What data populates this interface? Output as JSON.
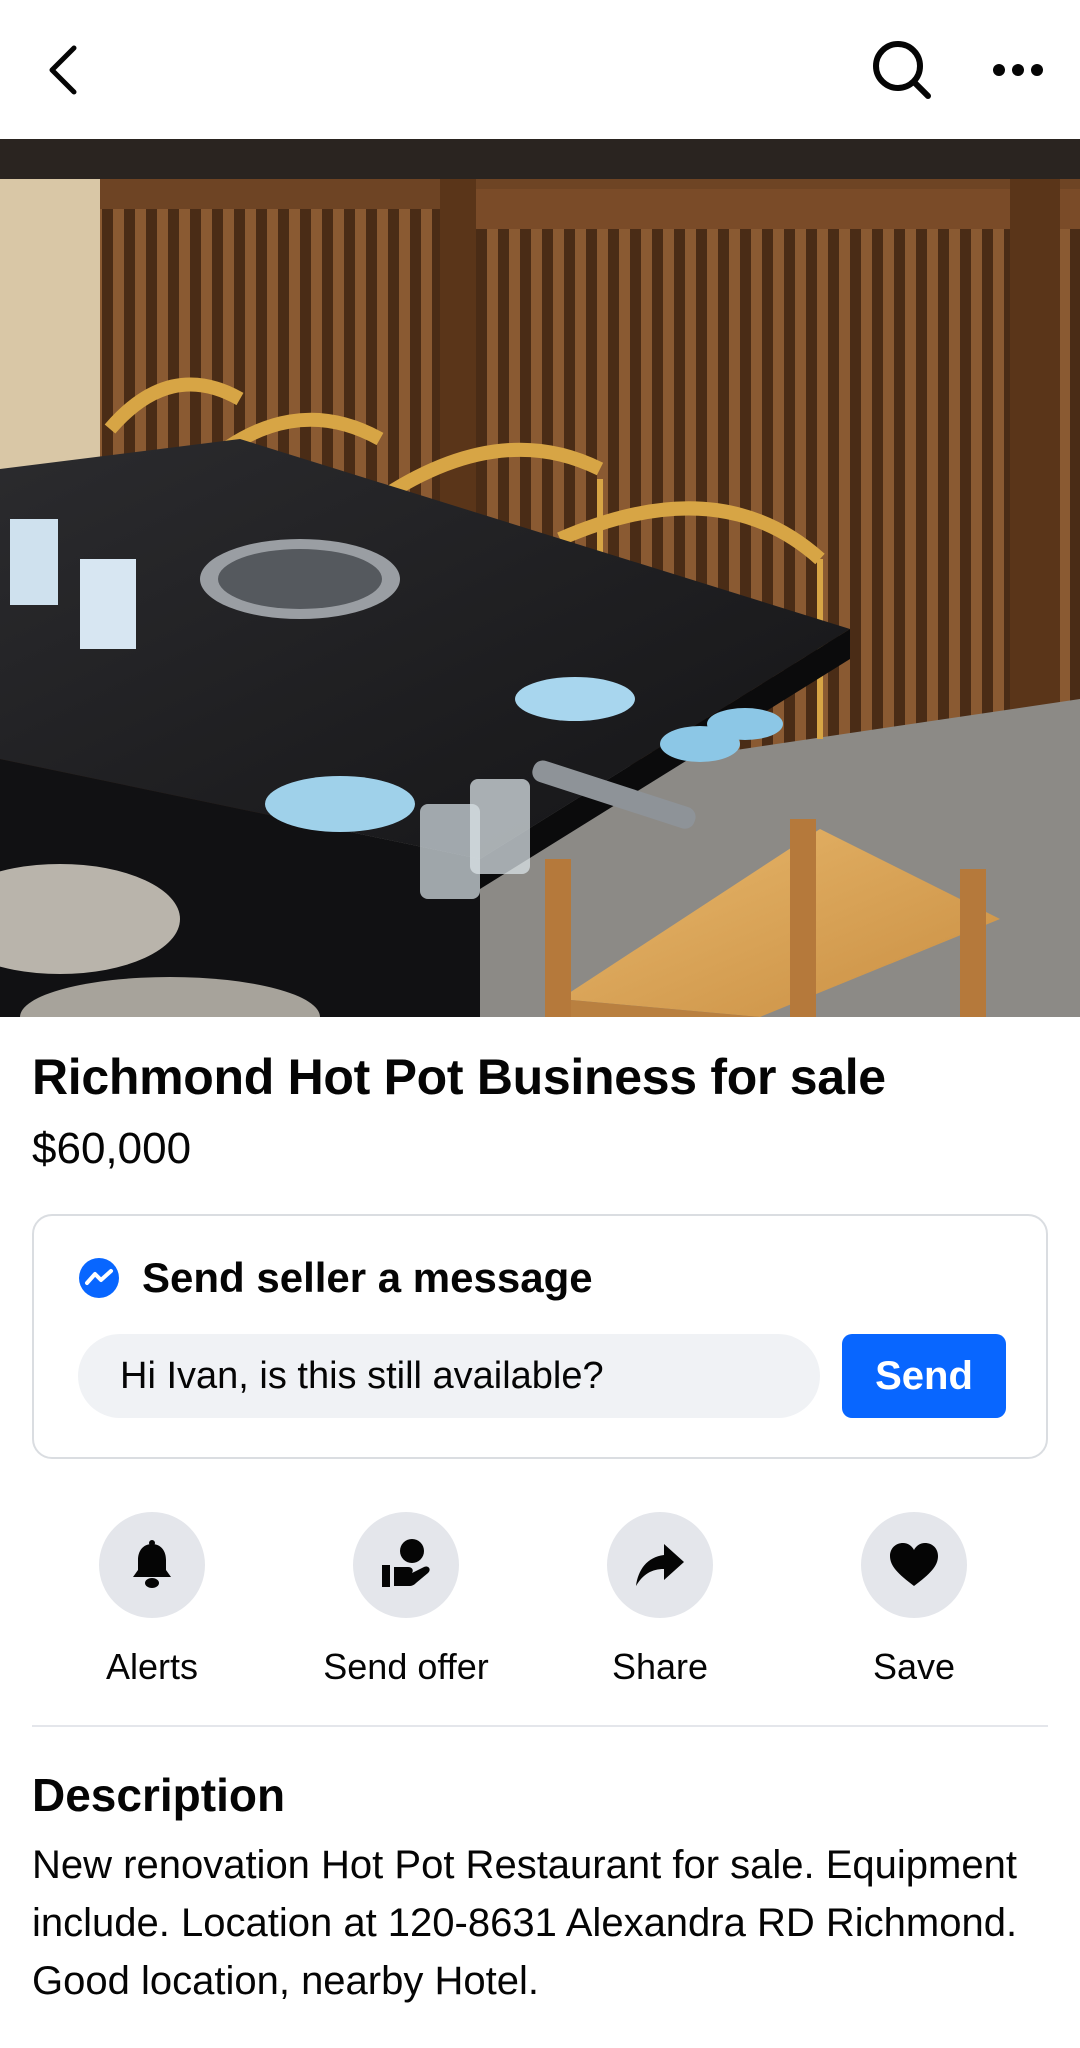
{
  "header": {
    "back_icon": "chevron-left-icon",
    "search_icon": "search-icon",
    "more_icon": "more-horizontal-icon"
  },
  "listing": {
    "photo_description": "listing-photo",
    "title": "Richmond Hot Pot Business for sale",
    "price": "$60,000"
  },
  "message": {
    "heading": "Send seller a message",
    "icon": "messenger-icon",
    "input_value": "Hi Ivan, is this still available?",
    "send_label": "Send"
  },
  "actions": [
    {
      "label": "Alerts",
      "icon": "bell-icon"
    },
    {
      "label": "Send offer",
      "icon": "offer-hand-icon"
    },
    {
      "label": "Share",
      "icon": "share-arrow-icon"
    },
    {
      "label": "Save",
      "icon": "heart-icon"
    }
  ],
  "description": {
    "heading": "Description",
    "text": "New renovation Hot Pot Restaurant for sale. Equipment include. Location at 120-8631 Alexandra RD Richmond. Good location, nearby Hotel."
  },
  "colors": {
    "accent": "#0866ff",
    "input_bg": "#f0f2f5",
    "action_circle": "#e4e6eb",
    "text": "#050505"
  }
}
